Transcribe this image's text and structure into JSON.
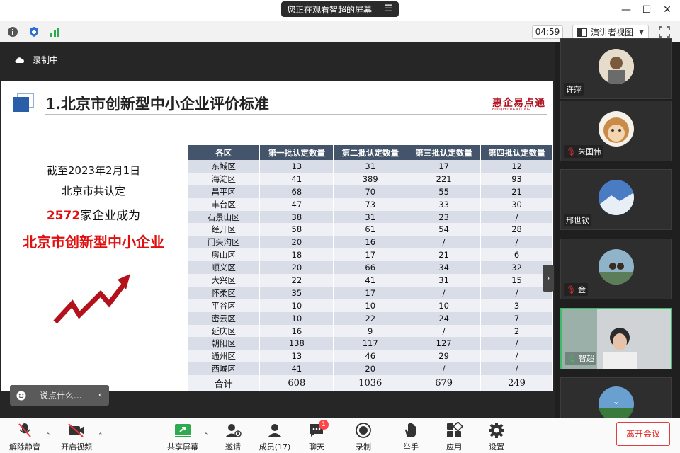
{
  "window": {
    "share_status": "您正在观看智超的屏幕",
    "timer": "04:59",
    "view_mode": "演讲者视图"
  },
  "recording": {
    "label": "录制中"
  },
  "slide": {
    "title": "1.北京市创新型中小企业评价标准",
    "logo": "惠企易点通",
    "logo_sub": "HUIQIYIDIANTONG",
    "left_line1": "截至2023年2月1日",
    "left_line2": "北京市共认定",
    "left_count": "2572",
    "left_line3_suffix": "家企业成为",
    "left_line4": "北京市创新型中小企业",
    "table": {
      "headers": [
        "各区",
        "第一批认定数量",
        "第二批认定数量",
        "第三批认定数量",
        "第四批认定数量"
      ],
      "rows": [
        [
          "东城区",
          "13",
          "31",
          "17",
          "12"
        ],
        [
          "海淀区",
          "41",
          "389",
          "221",
          "93"
        ],
        [
          "昌平区",
          "68",
          "70",
          "55",
          "21"
        ],
        [
          "丰台区",
          "47",
          "73",
          "33",
          "30"
        ],
        [
          "石景山区",
          "38",
          "31",
          "23",
          "/"
        ],
        [
          "经开区",
          "58",
          "61",
          "54",
          "28"
        ],
        [
          "门头沟区",
          "20",
          "16",
          "/",
          "/"
        ],
        [
          "房山区",
          "18",
          "17",
          "21",
          "6"
        ],
        [
          "顺义区",
          "20",
          "66",
          "34",
          "32"
        ],
        [
          "大兴区",
          "22",
          "41",
          "31",
          "15"
        ],
        [
          "怀柔区",
          "35",
          "17",
          "/",
          "/"
        ],
        [
          "平谷区",
          "10",
          "10",
          "10",
          "3"
        ],
        [
          "密云区",
          "10",
          "22",
          "24",
          "7"
        ],
        [
          "延庆区",
          "16",
          "9",
          "/",
          "2"
        ],
        [
          "朝阳区",
          "138",
          "117",
          "127",
          "/"
        ],
        [
          "通州区",
          "13",
          "46",
          "29",
          "/"
        ],
        [
          "西城区",
          "41",
          "20",
          "/",
          "/"
        ]
      ],
      "total": [
        "合计",
        "608",
        "1036",
        "679",
        "249"
      ]
    }
  },
  "chat_input": {
    "placeholder": "说点什么..."
  },
  "participants": [
    {
      "name": "许萍",
      "muted": false
    },
    {
      "name": "朱国伟",
      "muted": true
    },
    {
      "name": "邢世钦",
      "muted": false
    },
    {
      "name": "金",
      "muted": true
    },
    {
      "name": "智超",
      "muted": false,
      "speaking": true
    }
  ],
  "bottom_bar": {
    "unmute": "解除静音",
    "start_video": "开启视频",
    "share_screen": "共享屏幕",
    "invite": "邀请",
    "members": "成员(17)",
    "chat": "聊天",
    "chat_badge": "1",
    "record": "录制",
    "raise_hand": "举手",
    "apps": "应用",
    "settings": "设置",
    "leave": "离开会议"
  },
  "colors": {
    "accent_green": "#3dbb6b",
    "leave_red": "#e02020",
    "table_header": "#44546a",
    "highlight_red": "#e01010"
  }
}
